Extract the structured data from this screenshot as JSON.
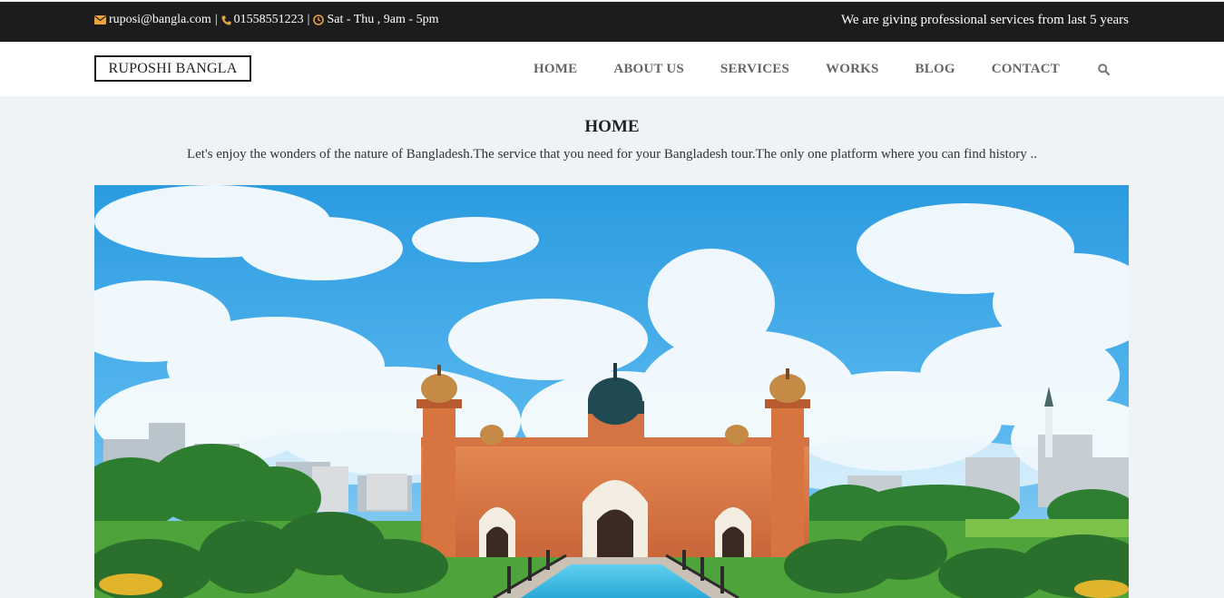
{
  "topbar": {
    "email": "ruposi@bangla.com",
    "separator": "|",
    "phone": "01558551223",
    "hours": "Sat - Thu , 9am - 5pm",
    "tagline": "We are giving professional services from last 5 years",
    "icons": [
      "envelope-icon",
      "phone-icon",
      "clock-icon"
    ],
    "icon_color": "#e8a33d"
  },
  "brand": {
    "name": "RUPOSHI BANGLA"
  },
  "nav": {
    "items": [
      "HOME",
      "ABOUT US",
      "SERVICES",
      "WORKS",
      "BLOG",
      "CONTACT"
    ],
    "search_icon": "search-icon"
  },
  "main": {
    "title": "HOME",
    "intro": "Let's enjoy the wonders of the nature of Bangladesh.The service that you need for your Bangladesh tour.The only one platform where you can find history .."
  },
  "hero": {
    "image": "photo of Lalbagh Fort mosque under a blue cloudy sky"
  },
  "colors": {
    "topbar_bg": "#1c1c1c",
    "page_bg": "#eff3f6",
    "nav_text": "#666666"
  }
}
